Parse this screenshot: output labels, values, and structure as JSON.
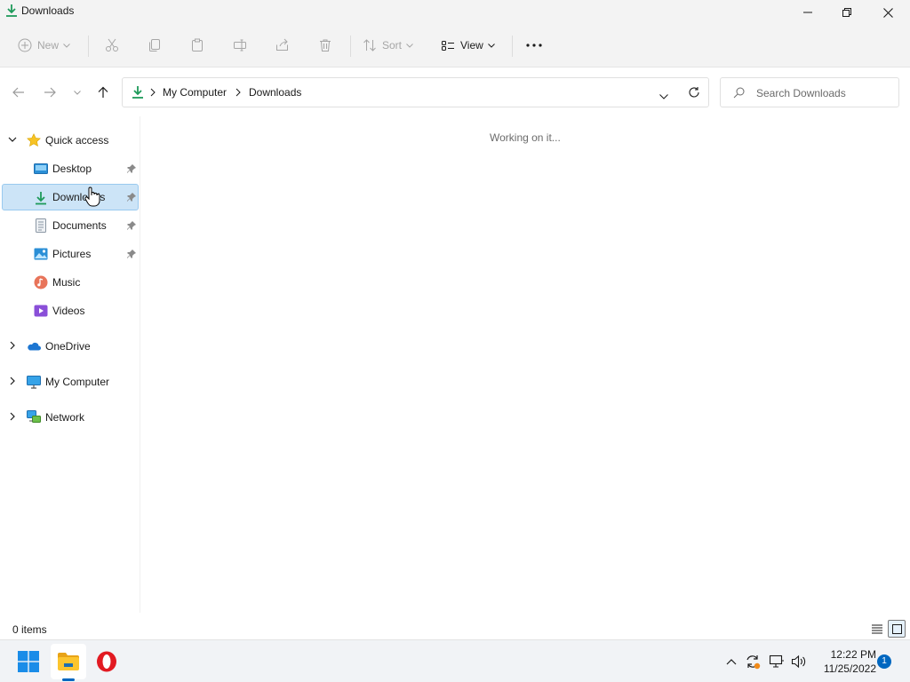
{
  "window": {
    "title": "Downloads"
  },
  "toolbar": {
    "new_label": "New",
    "sort_label": "Sort",
    "view_label": "View",
    "icons": [
      "plus-circle-icon",
      "cut-icon",
      "copy-icon",
      "paste-icon",
      "rename-icon",
      "share-icon",
      "delete-icon",
      "sort-icon",
      "view-icon",
      "more-icon"
    ]
  },
  "address": {
    "crumbs": [
      "My Computer",
      "Downloads"
    ],
    "search_placeholder": "Search Downloads"
  },
  "sidebar": {
    "quick_access": "Quick access",
    "items": [
      {
        "label": "Desktop",
        "icon": "desktop-icon",
        "pinned": true
      },
      {
        "label": "Downloads",
        "icon": "download-icon",
        "pinned": true,
        "selected": true
      },
      {
        "label": "Documents",
        "icon": "documents-icon",
        "pinned": true
      },
      {
        "label": "Pictures",
        "icon": "pictures-icon",
        "pinned": true
      },
      {
        "label": "Music",
        "icon": "music-icon",
        "pinned": false
      },
      {
        "label": "Videos",
        "icon": "videos-icon",
        "pinned": false
      }
    ],
    "roots": [
      {
        "label": "OneDrive",
        "icon": "onedrive-icon"
      },
      {
        "label": "My Computer",
        "icon": "computer-icon"
      },
      {
        "label": "Network",
        "icon": "network-icon"
      }
    ]
  },
  "content": {
    "status_message": "Working on it..."
  },
  "statusbar": {
    "items_count": "0 items"
  },
  "taskbar": {
    "time": "12:22 PM",
    "date": "11/25/2022",
    "notification_count": "1"
  },
  "colors": {
    "accent": "#0067c0",
    "selection": "#cce4f7",
    "download_green": "#1e9a5a"
  }
}
